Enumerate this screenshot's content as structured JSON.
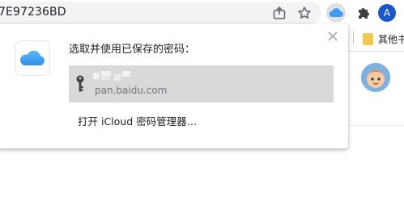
{
  "browser": {
    "url_text": "7E97236BD",
    "profile_initial": "A",
    "bookmark_folder_label": "其他书签"
  },
  "icloud_popup": {
    "title": "选取并使用已保存的密码：",
    "entries": [
      {
        "username": "",
        "domain": "pan.baidu.com"
      }
    ],
    "open_icloud_label": "打开 iCloud 密码管理器…"
  },
  "colors": {
    "accent_profile": "#1a57c8",
    "icloud_blue": "#3f9cf0",
    "row_highlight": "#d9d9d9"
  },
  "icons": {
    "share": "share-icon",
    "star": "star-icon",
    "icloud_extension": "icloud-extension-icon",
    "extensions": "puzzle-icon",
    "close": "close-icon",
    "key": "key-icon",
    "folder": "folder-icon"
  }
}
